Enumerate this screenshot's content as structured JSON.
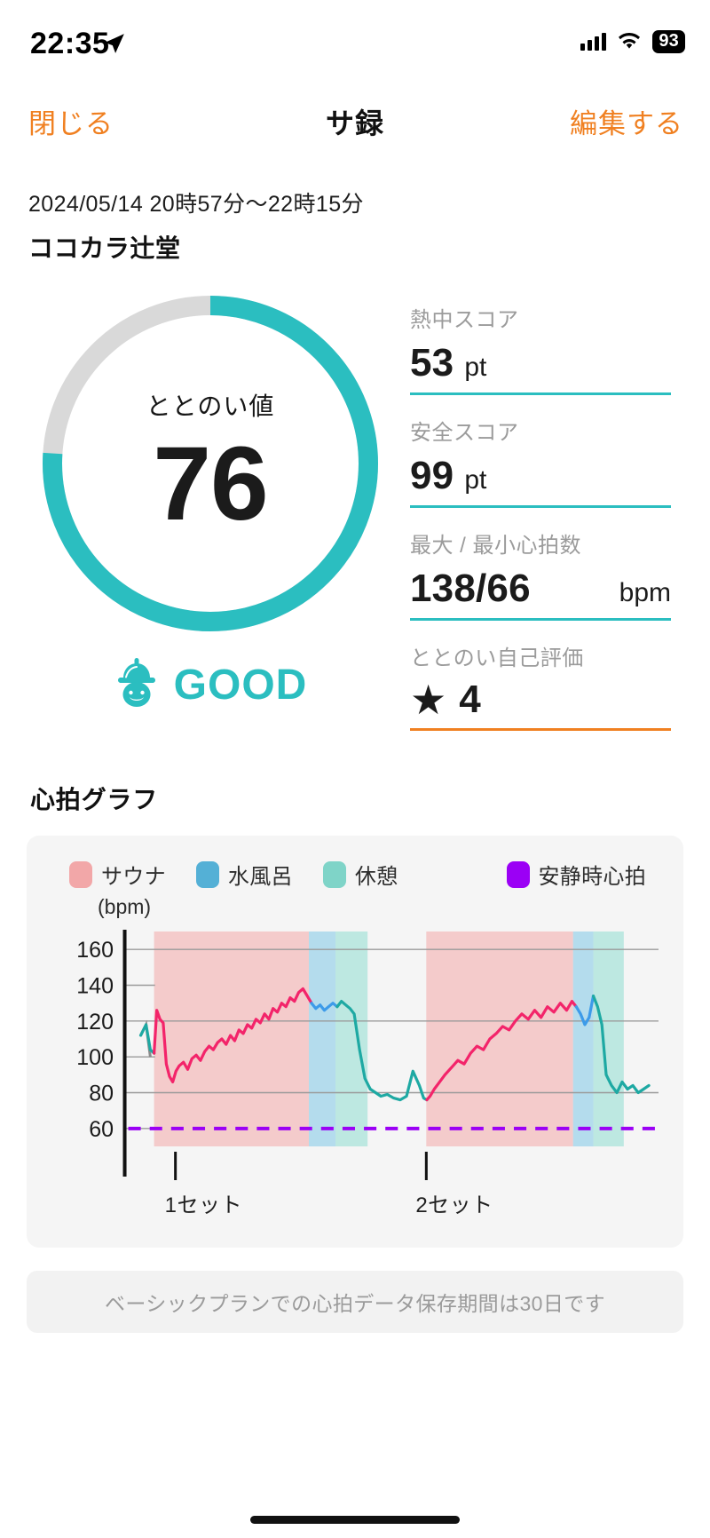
{
  "status_bar": {
    "time": "22:35",
    "battery": "93",
    "location_icon": "location-arrow-icon",
    "wifi_icon": "wifi-icon",
    "signal_icon": "cellular-signal-icon"
  },
  "nav": {
    "close_label": "閉じる",
    "title": "サ録",
    "edit_label": "編集する"
  },
  "session": {
    "datetime": "2024/05/14 20時57分〜22時15分",
    "place": "ココカラ辻堂"
  },
  "gauge": {
    "label": "ととのい値",
    "value": "76",
    "percent": 76,
    "ring_color": "#2BBEC0",
    "track_color": "#D9D9D9",
    "verdict_text": "GOOD",
    "verdict_icon": "sauna-hat-face-icon",
    "verdict_color": "#2BBEC0"
  },
  "stats": [
    {
      "label": "熱中スコア",
      "value": "53",
      "unit": "pt",
      "unit_align": "left",
      "underline": "#2BBEC0"
    },
    {
      "label": "安全スコア",
      "value": "99",
      "unit": "pt",
      "unit_align": "left",
      "underline": "#2BBEC0"
    },
    {
      "label": "最大 / 最小心拍数",
      "value": "138/66",
      "unit": "bpm",
      "unit_align": "right",
      "underline": "#2BBEC0"
    }
  ],
  "rating": {
    "label": "ととのい自己評価",
    "star": "★",
    "value": "4",
    "underline": "#F08021"
  },
  "chart_section": {
    "title": "心拍グラフ",
    "plan_note": "ベーシックプランでの心拍データ保存期間は30日です"
  },
  "chart_data": {
    "type": "line",
    "title": "心拍グラフ",
    "ylabel": "(bpm)",
    "xlabel": "",
    "ylim": [
      50,
      170
    ],
    "yticks": [
      160,
      140,
      120,
      100,
      80,
      60
    ],
    "grid": true,
    "legend_position": "top",
    "legend": [
      {
        "name": "サウナ",
        "color": "#F2A7A8"
      },
      {
        "name": "水風呂",
        "color": "#54B0D6"
      },
      {
        "name": "休憩",
        "color": "#7FD4C8"
      },
      {
        "name": "安静時心拍",
        "color": "#9B00F5"
      }
    ],
    "xticks": [
      {
        "label": "1セット",
        "pos": 0.095
      },
      {
        "label": "2セット",
        "pos": 0.565
      }
    ],
    "resting_hr": 60,
    "resting_hr_color": "#9B00F5",
    "line_colors": {
      "sauna": "#F3246A",
      "mizuburo": "#3D9BE9",
      "rest": "#1EA9A3",
      "pre": "#8A8A8A"
    },
    "bands": [
      {
        "phase": "サウナ",
        "x0": 0.055,
        "x1": 0.345,
        "fill": "#F2A7A8"
      },
      {
        "phase": "水風呂",
        "x0": 0.345,
        "x1": 0.395,
        "fill": "#7EC6E6"
      },
      {
        "phase": "休憩",
        "x0": 0.395,
        "x1": 0.455,
        "fill": "#8EDCD0"
      },
      {
        "phase": "サウナ",
        "x0": 0.565,
        "x1": 0.84,
        "fill": "#F2A7A8"
      },
      {
        "phase": "水風呂",
        "x0": 0.84,
        "x1": 0.878,
        "fill": "#7EC6E6"
      },
      {
        "phase": "休憩",
        "x0": 0.878,
        "x1": 0.935,
        "fill": "#8EDCD0"
      }
    ],
    "series": [
      {
        "name": "心拍数",
        "x": [
          0.03,
          0.04,
          0.048,
          0.055,
          0.06,
          0.066,
          0.072,
          0.078,
          0.084,
          0.09,
          0.096,
          0.102,
          0.11,
          0.118,
          0.126,
          0.134,
          0.142,
          0.15,
          0.158,
          0.166,
          0.174,
          0.182,
          0.19,
          0.198,
          0.206,
          0.214,
          0.222,
          0.23,
          0.238,
          0.246,
          0.254,
          0.262,
          0.27,
          0.278,
          0.286,
          0.294,
          0.302,
          0.31,
          0.318,
          0.326,
          0.334,
          0.342,
          0.35,
          0.358,
          0.366,
          0.374,
          0.382,
          0.39,
          0.398,
          0.406,
          0.414,
          0.422,
          0.43,
          0.44,
          0.45,
          0.46,
          0.47,
          0.48,
          0.492,
          0.504,
          0.516,
          0.528,
          0.54,
          0.552,
          0.56,
          0.566,
          0.572,
          0.58,
          0.59,
          0.6,
          0.612,
          0.624,
          0.636,
          0.648,
          0.66,
          0.672,
          0.684,
          0.696,
          0.708,
          0.72,
          0.732,
          0.744,
          0.756,
          0.768,
          0.78,
          0.792,
          0.804,
          0.816,
          0.828,
          0.838,
          0.846,
          0.854,
          0.862,
          0.87,
          0.878,
          0.886,
          0.894,
          0.902,
          0.912,
          0.922,
          0.932,
          0.942,
          0.952,
          0.962,
          0.972,
          0.982
        ],
        "y": [
          112,
          118,
          104,
          102,
          126,
          121,
          119,
          96,
          89,
          86,
          92,
          95,
          97,
          93,
          99,
          101,
          98,
          103,
          106,
          104,
          108,
          110,
          107,
          112,
          109,
          115,
          113,
          118,
          116,
          121,
          119,
          124,
          121,
          127,
          125,
          130,
          128,
          133,
          131,
          136,
          138,
          134,
          130,
          127,
          129,
          126,
          128,
          130,
          128,
          131,
          129,
          127,
          124,
          104,
          88,
          82,
          80,
          78,
          79,
          77,
          76,
          78,
          92,
          84,
          77,
          76,
          78,
          82,
          86,
          90,
          94,
          98,
          96,
          102,
          106,
          104,
          110,
          113,
          117,
          115,
          120,
          124,
          121,
          126,
          122,
          128,
          125,
          130,
          126,
          131,
          128,
          124,
          118,
          122,
          134,
          128,
          118,
          90,
          84,
          80,
          86,
          82,
          84,
          80,
          82,
          84
        ]
      }
    ]
  }
}
